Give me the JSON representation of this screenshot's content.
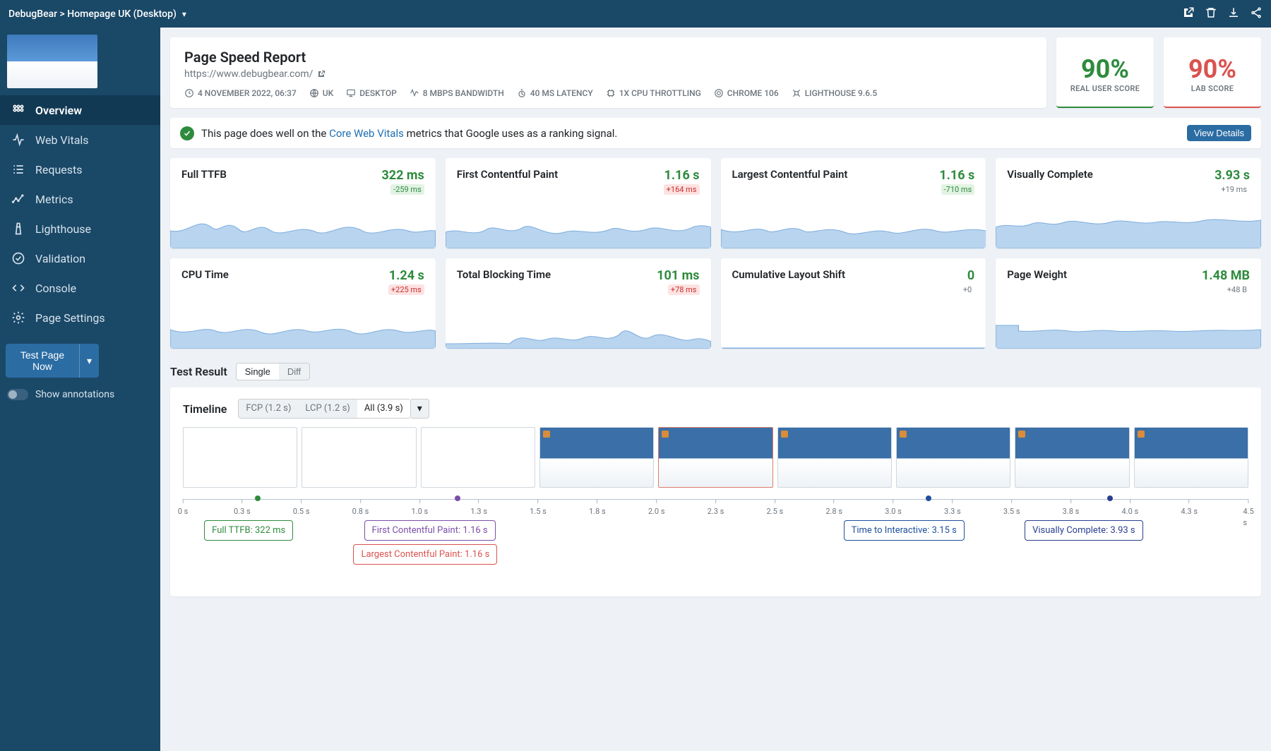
{
  "topbar": {
    "breadcrumb": "DebugBear > Homepage UK (Desktop)"
  },
  "sidebar": {
    "nav": [
      {
        "label": "Overview",
        "icon": "grid"
      },
      {
        "label": "Web Vitals",
        "icon": "activity"
      },
      {
        "label": "Requests",
        "icon": "list"
      },
      {
        "label": "Metrics",
        "icon": "chart"
      },
      {
        "label": "Lighthouse",
        "icon": "lighthouse"
      },
      {
        "label": "Validation",
        "icon": "check"
      },
      {
        "label": "Console",
        "icon": "code"
      },
      {
        "label": "Page Settings",
        "icon": "gear"
      }
    ],
    "test_btn": "Test Page Now",
    "annotations_label": "Show annotations"
  },
  "header": {
    "title": "Page Speed Report",
    "url": "https://www.debugbear.com/",
    "meta": [
      {
        "label": "4 NOVEMBER 2022, 06:37"
      },
      {
        "label": "UK"
      },
      {
        "label": "DESKTOP"
      },
      {
        "label": "8 MBPS BANDWIDTH"
      },
      {
        "label": "40 MS LATENCY"
      },
      {
        "label": "1X CPU THROTTLING"
      },
      {
        "label": "CHROME 106"
      },
      {
        "label": "LIGHTHOUSE 9.6.5"
      }
    ]
  },
  "scores": {
    "real_user": {
      "value": "90%",
      "label": "REAL USER SCORE"
    },
    "lab": {
      "value": "90%",
      "label": "LAB SCORE"
    }
  },
  "vitals_banner": {
    "prefix": "This page does well on the ",
    "link": "Core Web Vitals",
    "suffix": " metrics that Google uses as a ranking signal.",
    "btn": "View Details"
  },
  "metrics": [
    {
      "name": "Full TTFB",
      "value": "322 ms",
      "delta": "-259 ms",
      "delta_cls": "good"
    },
    {
      "name": "First Contentful Paint",
      "value": "1.16 s",
      "delta": "+164 ms",
      "delta_cls": "bad"
    },
    {
      "name": "Largest Contentful Paint",
      "value": "1.16 s",
      "delta": "-710 ms",
      "delta_cls": "good"
    },
    {
      "name": "Visually Complete",
      "value": "3.93 s",
      "delta": "+19 ms",
      "delta_cls": "neutral"
    },
    {
      "name": "CPU Time",
      "value": "1.24 s",
      "delta": "+225 ms",
      "delta_cls": "bad"
    },
    {
      "name": "Total Blocking Time",
      "value": "101 ms",
      "delta": "+78 ms",
      "delta_cls": "bad"
    },
    {
      "name": "Cumulative Layout Shift",
      "value": "0",
      "delta": "+0",
      "delta_cls": "neutral"
    },
    {
      "name": "Page Weight",
      "value": "1.48 MB",
      "delta": "+48 B",
      "delta_cls": "neutral"
    }
  ],
  "test_result": {
    "title": "Test Result",
    "tabs": [
      "Single",
      "Diff"
    ]
  },
  "timeline": {
    "title": "Timeline",
    "tabs": [
      "FCP (1.2 s)",
      "LCP (1.2 s)",
      "All (3.9 s)"
    ],
    "ticks": [
      "0 s",
      "0.3 s",
      "0.5 s",
      "0.8 s",
      "1.0 s",
      "1.3 s",
      "1.5 s",
      "1.8 s",
      "2.0 s",
      "2.3 s",
      "2.5 s",
      "2.8 s",
      "3.0 s",
      "3.3 s",
      "3.5 s",
      "3.8 s",
      "4.0 s",
      "4.3 s",
      "4.5 s"
    ],
    "callouts": {
      "ttfb": "Full TTFB: 322 ms",
      "fcp": "First Contentful Paint: 1.16 s",
      "lcp": "Largest Contentful Paint: 1.16 s",
      "tti": "Time to Interactive: 3.15 s",
      "vc": "Visually Complete: 3.93 s"
    }
  },
  "chart_data": {
    "type": "table",
    "title": "Metric Cards",
    "series": [
      {
        "name": "Full TTFB",
        "value_ms": 322,
        "delta_ms": -259
      },
      {
        "name": "First Contentful Paint",
        "value_s": 1.16,
        "delta_ms": 164
      },
      {
        "name": "Largest Contentful Paint",
        "value_s": 1.16,
        "delta_ms": -710
      },
      {
        "name": "Visually Complete",
        "value_s": 3.93,
        "delta_ms": 19
      },
      {
        "name": "CPU Time",
        "value_s": 1.24,
        "delta_ms": 225
      },
      {
        "name": "Total Blocking Time",
        "value_ms": 101,
        "delta_ms": 78
      },
      {
        "name": "Cumulative Layout Shift",
        "value": 0,
        "delta": 0
      },
      {
        "name": "Page Weight",
        "value_mb": 1.48,
        "delta_b": 48
      }
    ],
    "timeline_markers": [
      {
        "label": "Full TTFB",
        "time_s": 0.322
      },
      {
        "label": "First Contentful Paint",
        "time_s": 1.16
      },
      {
        "label": "Largest Contentful Paint",
        "time_s": 1.16
      },
      {
        "label": "Time to Interactive",
        "time_s": 3.15
      },
      {
        "label": "Visually Complete",
        "time_s": 3.93
      }
    ],
    "timeline_range_s": [
      0,
      4.5
    ]
  }
}
